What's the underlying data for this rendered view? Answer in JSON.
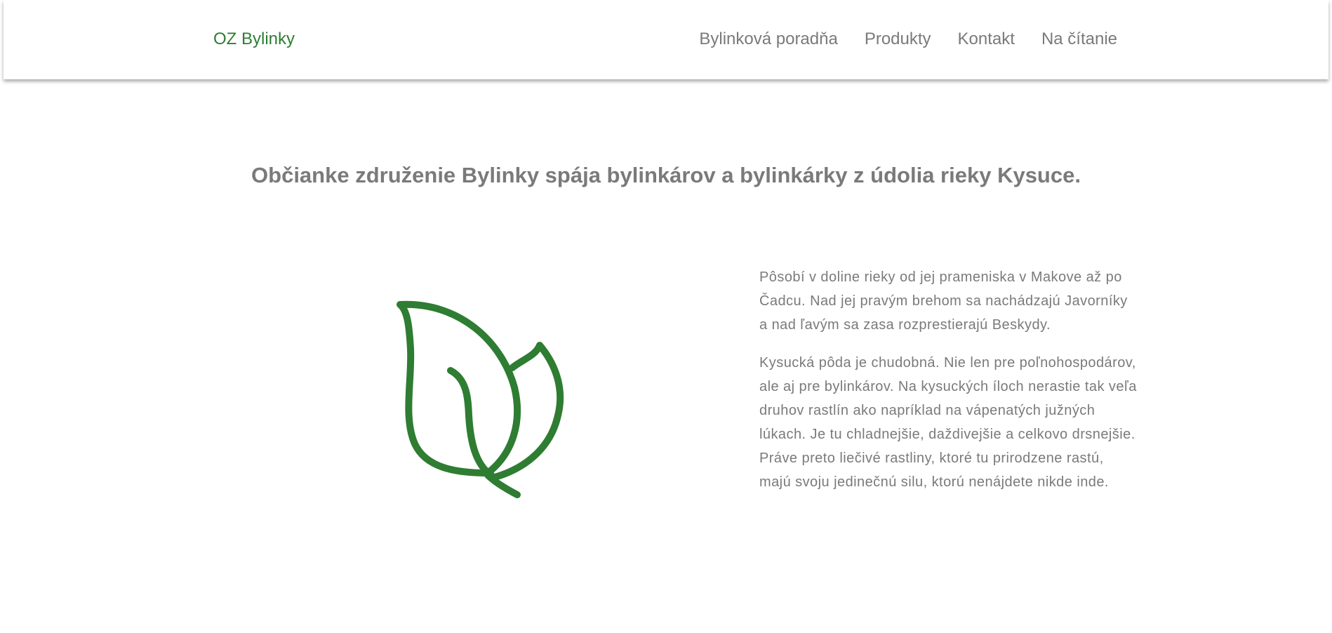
{
  "navbar": {
    "brand": "OZ Bylinky",
    "links": [
      "Bylinková poradňa",
      "Produkty",
      "Kontakt",
      "Na čítanie"
    ]
  },
  "hero": {
    "headline": "Občianke združenie Bylinky spája bylinkárov a bylinkárky z údolia rieky Kysuce."
  },
  "content": {
    "paragraphs": [
      "Pôsobí v doline rieky od jej prameniska v Makove až po Čadcu. Nad jej pravým brehom sa nachádzajú Javorníky a nad ľavým sa zasa rozprestierajú Beskydy.",
      "Kysucká pôda je chudobná. Nie len pre poľnohospodárov, ale aj pre bylinkárov. Na kysuckých íloch nerastie tak veľa druhov rastlín ako napríklad na vápenatých južných lúkach. Je tu chladnejšie, daždivejšie a celkovo drsnejšie. Práve preto liečivé rastliny, ktoré tu prirodzene rastú, majú svoju jedinečnú silu, ktorú nenájdete nikde inde."
    ]
  },
  "icons": {
    "leaf": "leaf-icon"
  },
  "colors": {
    "brand": "#2e7d32",
    "text": "#7a7a7a"
  }
}
